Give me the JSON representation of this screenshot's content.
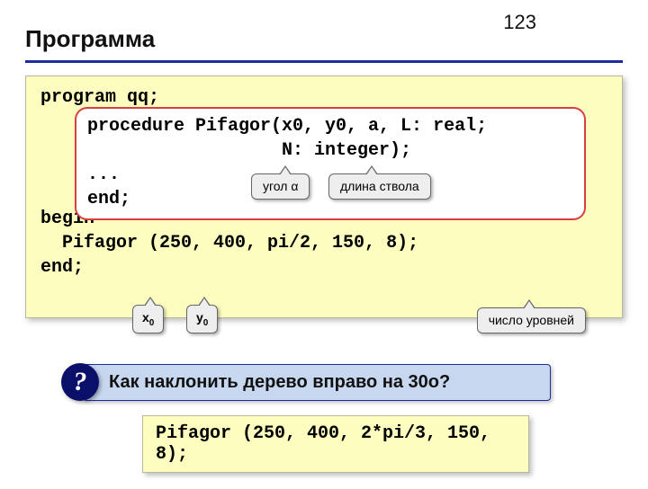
{
  "page_number": "123",
  "title": "Программа",
  "code": {
    "l1": "program qq;",
    "l2": "",
    "l3": "",
    "l4": "",
    "l5": "",
    "l6": "begin",
    "l7": "  Pifagor (250, 400, pi/2, 150, 8);",
    "l8": "end;"
  },
  "proc": {
    "l1": "procedure Pifagor(x0, y0, a, L: real;",
    "l2": "                  N: integer);",
    "l3": "...",
    "l4": "end;"
  },
  "callouts": {
    "angle": "угол α",
    "length": "длина ствола",
    "x0": "x",
    "x0_sub": "0",
    "y0": "y",
    "y0_sub": "0",
    "levels": "число уровней"
  },
  "question_mark": "?",
  "question": "Как наклонить дерево вправо на 30о?",
  "answer": "Pifagor (250, 400, 2*pi/3, 150, 8);"
}
